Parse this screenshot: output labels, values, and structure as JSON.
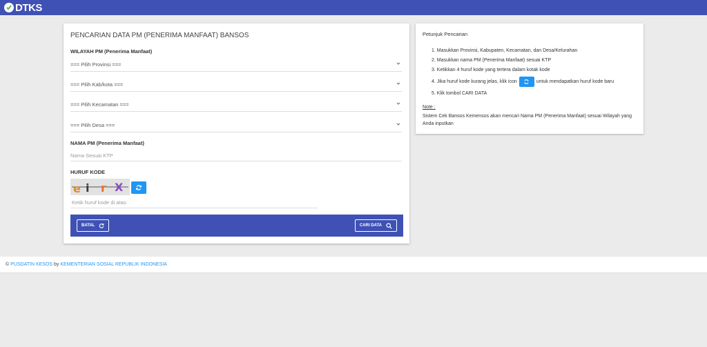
{
  "brand": {
    "logo_text": "DTKS"
  },
  "form": {
    "title": "PENCARIAN DATA PM (PENERIMA MANFAAT) BANSOS",
    "wilayah_label": "WILAYAH PM (Penerima Manfaat)",
    "selects": [
      {
        "value": "=== Pilih Provinsi ==="
      },
      {
        "value": "=== Pilih Kab/kota ==="
      },
      {
        "value": "=== Pilih Kecamatan ==="
      },
      {
        "value": "=== Pilih Desa ==="
      }
    ],
    "nama_label": "NAMA PM (Penerima Manfaat)",
    "nama_placeholder": "Nama Sesuai KTP",
    "kode_label": "HURUF KODE",
    "captcha_text": "eirX",
    "kode_placeholder": "Ketik huruf kode di atas:",
    "batal_label": "BATAL",
    "cari_label": "CARI DATA"
  },
  "instructions": {
    "title": "Petunjuk Pencarian",
    "steps": [
      "1. Masukkan Provinsi, Kabupaten, Kecamatan, dan Desa/Kelurahan",
      "2. Masukkan nama PM (Penerima Manfaat) sesuai KTP",
      "3. Ketikkan 4 huruf kode yang tertera dalam kotak kode",
      "4. Jika huruf kode kurang jelas, klik icon",
      "5. Klik tombol CARI DATA"
    ],
    "step4_suffix": "untuk mendapatkan huruf kode baru",
    "note_title": "Note :",
    "note_text": "Sistem Cek Bansos Kemensos akan mencari Nama PM (Penerima Manfaat) sesuai Wilayah yang Anda inputkan"
  },
  "footer": {
    "copyright": "©",
    "org_link": "PUSDATIN KESOS",
    "by": "by",
    "ministry_link": "KEMENTERIAN SOSIAL REPUBLIK INDONESIA"
  },
  "colors": {
    "primary": "#3f51b5",
    "accent": "#2196f3"
  }
}
